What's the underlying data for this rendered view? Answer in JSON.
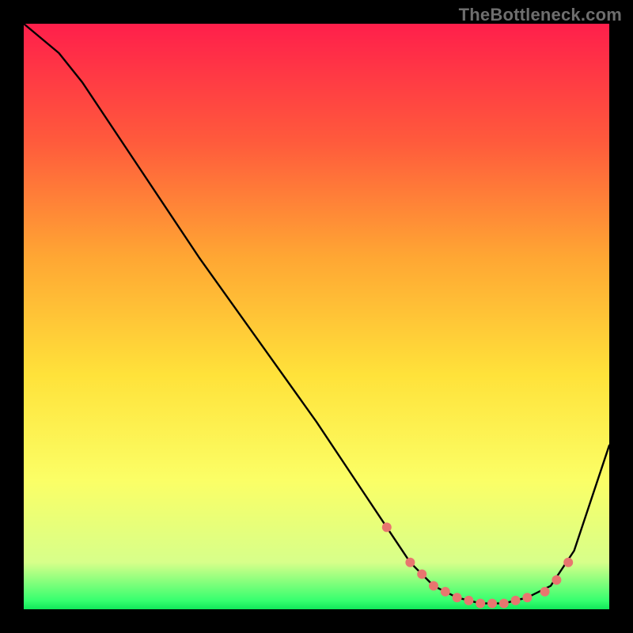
{
  "watermark": "TheBottleneck.com",
  "chart_data": {
    "type": "line",
    "title": "",
    "xlabel": "",
    "ylabel": "",
    "xlim": [
      0,
      100
    ],
    "ylim": [
      0,
      100
    ],
    "grid": false,
    "legend": false,
    "gradient_stops": [
      {
        "offset": 0.0,
        "color": "#ff1f4b"
      },
      {
        "offset": 0.2,
        "color": "#ff5a3c"
      },
      {
        "offset": 0.4,
        "color": "#ffa733"
      },
      {
        "offset": 0.6,
        "color": "#ffe23a"
      },
      {
        "offset": 0.78,
        "color": "#fbff66"
      },
      {
        "offset": 0.92,
        "color": "#d7ff8a"
      },
      {
        "offset": 0.985,
        "color": "#37ff6f"
      },
      {
        "offset": 1.0,
        "color": "#11e85a"
      }
    ],
    "series": [
      {
        "name": "bottleneck-curve",
        "stroke": "#000000",
        "x": [
          0,
          6,
          10,
          20,
          30,
          40,
          50,
          58,
          62,
          66,
          70,
          74,
          78,
          82,
          86,
          90,
          94,
          100
        ],
        "y": [
          100,
          95,
          90,
          75,
          60,
          46,
          32,
          20,
          14,
          8,
          4,
          2,
          1,
          1,
          2,
          4,
          10,
          28
        ]
      }
    ],
    "markers": {
      "name": "highlight-dots",
      "color": "#e8766f",
      "radius": 6,
      "x": [
        62,
        66,
        68,
        70,
        72,
        74,
        76,
        78,
        80,
        82,
        84,
        86,
        89,
        91,
        93
      ],
      "y": [
        14,
        8,
        6,
        4,
        3,
        2,
        1.5,
        1,
        1,
        1,
        1.5,
        2,
        3,
        5,
        8
      ]
    }
  }
}
